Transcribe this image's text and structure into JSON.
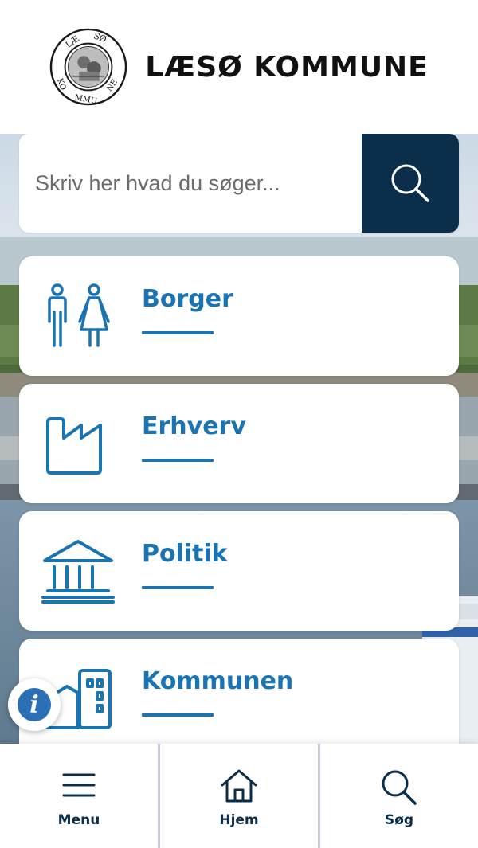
{
  "header": {
    "brand": "LÆSØ KOMMUNE",
    "seal_top_text": "LÆSØ",
    "seal_bottom_text": "KOMMUNE"
  },
  "search": {
    "placeholder": "Skriv her hvad du søger...",
    "button_icon": "search-icon"
  },
  "categories": [
    {
      "label": "Borger",
      "icon": "people-icon"
    },
    {
      "label": "Erhverv",
      "icon": "factory-icon"
    },
    {
      "label": "Politik",
      "icon": "government-building-icon"
    },
    {
      "label": "Kommunen",
      "icon": "municipality-buildings-icon"
    }
  ],
  "info_button": {
    "glyph": "i"
  },
  "bottom_nav": [
    {
      "label": "Menu",
      "icon": "hamburger-menu-icon"
    },
    {
      "label": "Hjem",
      "icon": "home-icon"
    },
    {
      "label": "Søg",
      "icon": "search-icon"
    }
  ],
  "colors": {
    "accent_blue": "#1a74b2",
    "dark_navy": "#0b2f4a",
    "brand_text": "#111111"
  }
}
